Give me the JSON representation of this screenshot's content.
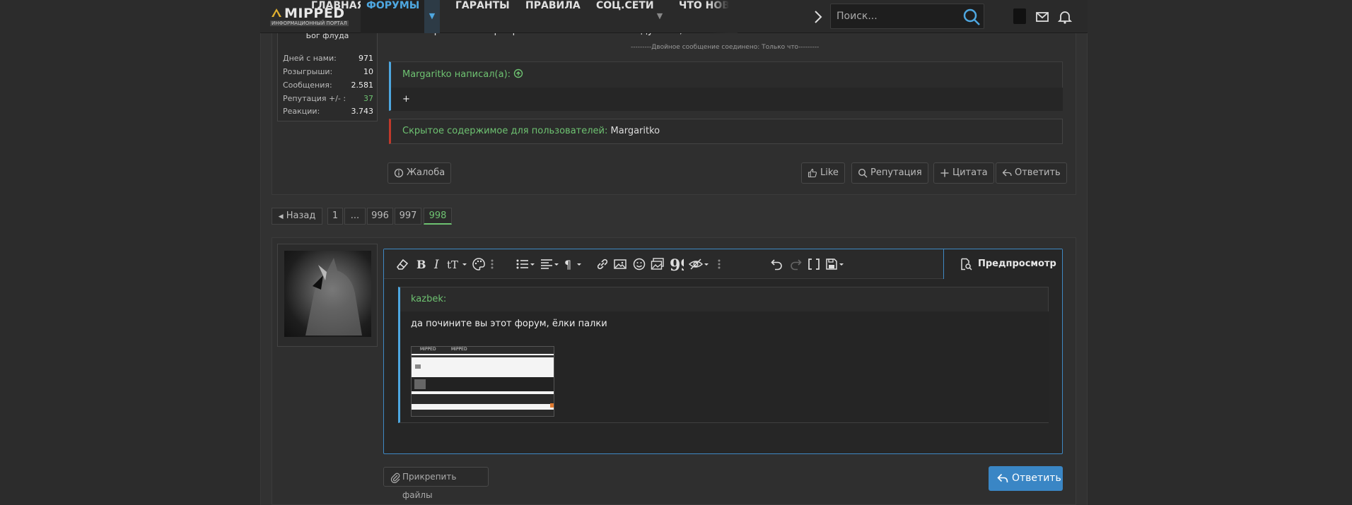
{
  "nav": {
    "logo_text": "MIPPED",
    "logo_sub": "ИНФОРМАЦИОННЫЙ ПОРТАЛ",
    "items": [
      {
        "label": "ГЛАВНАЯ"
      },
      {
        "label": "ФОРУМЫ"
      },
      {
        "label": "ГАРАНТЫ"
      },
      {
        "label": "ПРАВИЛА"
      },
      {
        "label": "СОЦ.СЕТИ"
      },
      {
        "label": "ЧТО НОВО"
      }
    ],
    "search_placeholder": "Поиск...",
    "active_color": "#4ea7e0"
  },
  "post": {
    "user_title": "Бог флуда",
    "stats": [
      {
        "label": "Дней с нами:",
        "value": "971"
      },
      {
        "label": "Розыгрыши:",
        "value": "10"
      },
      {
        "label": "Сообщения:",
        "value": "2.581"
      },
      {
        "label": "Репутация +/- :",
        "value": "37"
      },
      {
        "label": "Реакции:",
        "value": "3.743"
      }
    ],
    "cut_text": "а то что реклама перекрывает посты это так задумано, как я понял",
    "merge_note": "---------Двойное сообщение соединено: Только что---------",
    "quote_author": "Margaritko написал(а):",
    "quote_body": "+",
    "hidden_label": "Скрытое содержимое для пользователей:",
    "hidden_user": "Margaritko",
    "actions": {
      "report": "Жалоба",
      "like": "Like",
      "reputation": "Репутация",
      "quote": "Цитата",
      "reply": "Ответить"
    }
  },
  "pagination": {
    "prev": "Назад",
    "pages": [
      "1",
      "...",
      "996",
      "997",
      "998"
    ],
    "current": "998"
  },
  "editor": {
    "preview_label": "Предпросмотр",
    "quote_author": "kazbek:",
    "quote_text": "да почините вы этот форум, ёлки палки",
    "thumb_logo": "MIPPED"
  },
  "footer": {
    "attach_label": "Прикрепить файлы",
    "reply_label": "Ответить",
    "reply_color": "#3a86c5"
  }
}
